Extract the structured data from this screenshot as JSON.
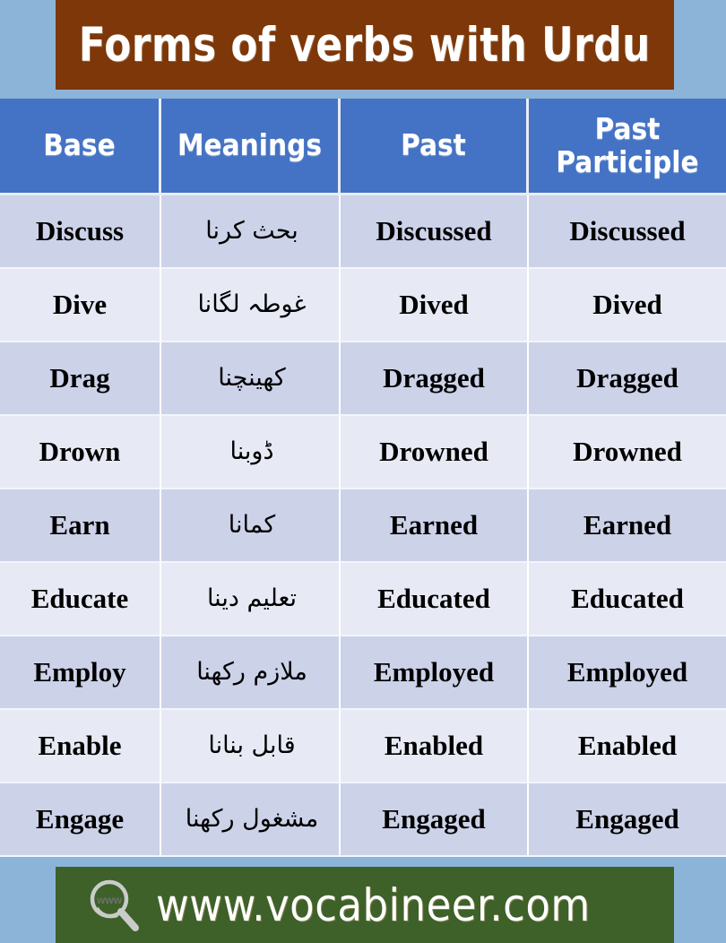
{
  "title": {
    "text": "Forms of verbs with Urdu",
    "banner_color": "#7d3708",
    "text_color": "#ffffff"
  },
  "page": {
    "background_color": "#8cb4d9"
  },
  "table": {
    "header_color": "#4472c4",
    "row_odd_color": "#ccd2e8",
    "row_even_color": "#e7eaf5",
    "columns": [
      {
        "key": "base",
        "label": "Base"
      },
      {
        "key": "meanings",
        "label": "Meanings"
      },
      {
        "key": "past",
        "label": "Past"
      },
      {
        "key": "past_participle",
        "label": "Past\nParticiple"
      }
    ],
    "rows": [
      {
        "base": "Discuss",
        "meanings": "بحث کرنا",
        "past": "Discussed",
        "past_participle": "Discussed"
      },
      {
        "base": "Dive",
        "meanings": "غوطہ لگانا",
        "past": "Dived",
        "past_participle": "Dived"
      },
      {
        "base": "Drag",
        "meanings": "کھینچنا",
        "past": "Dragged",
        "past_participle": "Dragged"
      },
      {
        "base": "Drown",
        "meanings": "ڈوبنا",
        "past": "Drowned",
        "past_participle": "Drowned"
      },
      {
        "base": "Earn",
        "meanings": "کمانا",
        "past": "Earned",
        "past_participle": "Earned"
      },
      {
        "base": "Educate",
        "meanings": "تعلیم دینا",
        "past": "Educated",
        "past_participle": "Educated"
      },
      {
        "base": "Employ",
        "meanings": "ملازم رکھنا",
        "past": "Employed",
        "past_participle": "Employed"
      },
      {
        "base": "Enable",
        "meanings": "قابل بنانا",
        "past": "Enabled",
        "past_participle": "Enabled"
      },
      {
        "base": "Engage",
        "meanings": "مشغول رکھنا",
        "past": "Engaged",
        "past_participle": "Engaged"
      }
    ]
  },
  "footer": {
    "url": "www.vocabineer.com",
    "icon_label": "www",
    "background_color": "#3d6129",
    "text_color": "#ffffff"
  }
}
